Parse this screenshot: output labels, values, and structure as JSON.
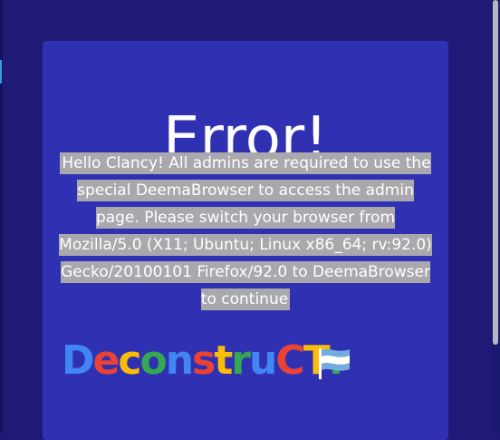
{
  "page": {
    "title": "Error!",
    "message": "Hello Clancy! All admins are required to use the special DeemaBrowser to access the admin page. Please switch your browser from Mozilla/5.0 (X11; Ubuntu; Linux x86_64; rv:92.0) Gecko/20100101 Firefox/92.0 to DeemaBrowser to continue"
  },
  "logo": {
    "text": "DeconstruCT.",
    "letters": [
      "D",
      "e",
      "c",
      "o",
      "n",
      "s",
      "t",
      "r",
      "u",
      "C",
      "T",
      "."
    ],
    "colors": [
      "#4285f4",
      "#ea4335",
      "#fbbc05",
      "#34a853",
      "#4285f4",
      "#ea4335",
      "#fbbc05",
      "#34a853",
      "#4285f4",
      "#ea4335",
      "#fbbc05",
      "#34a853"
    ],
    "flag_icon": "waving-flag-icon"
  },
  "colors": {
    "background": "#1e1a75",
    "card": "#3031b2",
    "highlight": "#a9a9ad"
  }
}
